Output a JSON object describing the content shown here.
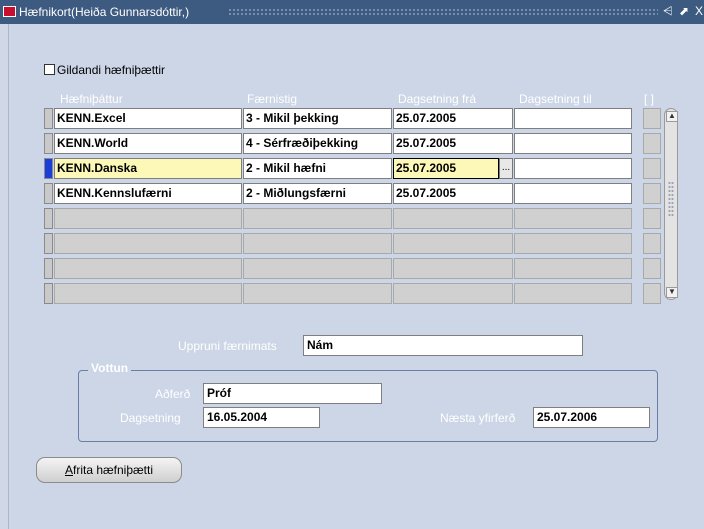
{
  "window": {
    "title": "Hæfnikort(Heiða Gunnarsdóttir,)",
    "controls": [
      "⩤",
      "⬈",
      "X"
    ]
  },
  "filter": {
    "checkbox_label": "Gildandi hæfniþættir",
    "checked": false
  },
  "table": {
    "headers": {
      "col1": "Hæfniþáttur",
      "col2": "Færnistig",
      "col3": "Dagsetning frá",
      "col4": "Dagsetning til",
      "col5": "[ ]"
    },
    "rows": [
      {
        "competence": "KENN.Excel",
        "level": "3 - Mikil þekking",
        "from": "25.07.2005",
        "to": ""
      },
      {
        "competence": "KENN.World",
        "level": "4 - Sérfræðiþekking",
        "from": "25.07.2005",
        "to": ""
      },
      {
        "competence": "KENN.Danska",
        "level": "2 - Mikil hæfni",
        "from": "25.07.2005",
        "to": ""
      },
      {
        "competence": "KENN.Kennslufærni",
        "level": "2 - Miðlungsfærni",
        "from": "25.07.2005",
        "to": ""
      }
    ],
    "active_row": 3,
    "calendar_glyph": "..."
  },
  "source": {
    "label": "Uppruni færnimats",
    "value": "Nám"
  },
  "certification": {
    "title": "Vottun",
    "method_label": "Aðferð",
    "method_value": "Próf",
    "date_label": "Dagsetning",
    "date_value": "16.05.2004",
    "next_review_label": "Næsta yfirferð",
    "next_review_value": "25.07.2006"
  },
  "actions": {
    "copy_button_label": "frita hæfniþætti",
    "copy_button_mnemonic": "A"
  },
  "colors": {
    "titlebar": "#3d5a80",
    "canvas": "#ccd6e6",
    "active_field": "#fdf7b8",
    "current_record_indicator": "#1b3fd6"
  }
}
